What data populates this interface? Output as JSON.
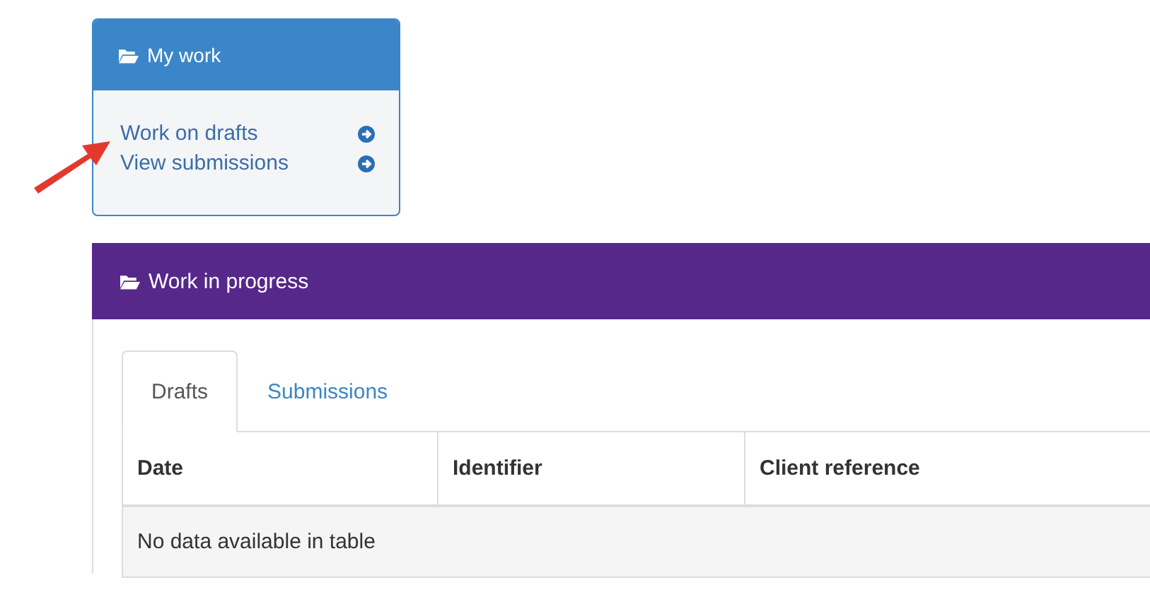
{
  "my_work": {
    "title": "My work",
    "links": [
      {
        "label": "Work on drafts"
      },
      {
        "label": "View submissions"
      }
    ]
  },
  "work_in_progress": {
    "title": "Work in progress",
    "tabs": [
      {
        "label": "Drafts",
        "selected": true
      },
      {
        "label": "Submissions",
        "selected": false
      }
    ],
    "table": {
      "columns": [
        "Date",
        "Identifier",
        "Client reference"
      ],
      "empty_message": "No data available in table"
    }
  }
}
